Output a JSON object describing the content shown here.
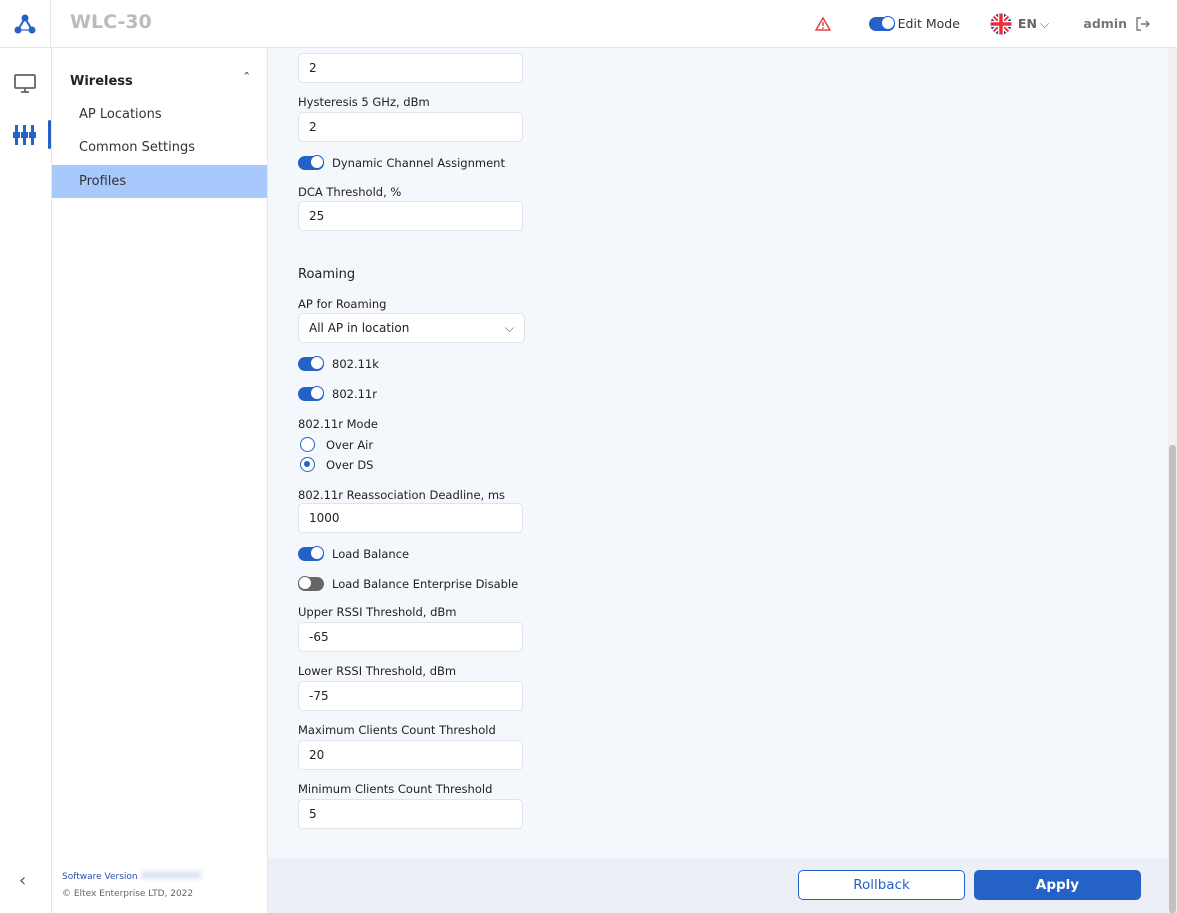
{
  "header": {
    "title": "WLC-30",
    "edit_mode_label": "Edit Mode",
    "language": "EN",
    "user": "admin"
  },
  "sidebar": {
    "group": "Wireless",
    "items": [
      {
        "label": "AP Locations"
      },
      {
        "label": "Common Settings"
      },
      {
        "label": "Profiles",
        "active": true
      }
    ],
    "software_version_label": "Software Version",
    "copyright": "© Eltex Enterprise LTD, 2022"
  },
  "form": {
    "field_top_value": "2",
    "hysteresis5_label": "Hysteresis 5 GHz, dBm",
    "hysteresis5_value": "2",
    "dca_label": "Dynamic Channel Assignment",
    "dca_on": true,
    "dca_threshold_label": "DCA Threshold, %",
    "dca_threshold_value": "25",
    "roaming_title": "Roaming",
    "ap_roaming_label": "AP for Roaming",
    "ap_roaming_value": "All AP in location",
    "k_label": "802.11k",
    "k_on": true,
    "r_label": "802.11r",
    "r_on": true,
    "r_mode_label": "802.11r Mode",
    "r_mode_options": [
      "Over Air",
      "Over DS"
    ],
    "r_mode_selected": "Over DS",
    "reassoc_label": "802.11r Reassociation Deadline, ms",
    "reassoc_value": "1000",
    "lb_label": "Load Balance",
    "lb_on": true,
    "lbe_label": "Load Balance Enterprise Disable",
    "lbe_on": false,
    "upper_rssi_label": "Upper RSSI Threshold, dBm",
    "upper_rssi_value": "-65",
    "lower_rssi_label": "Lower RSSI Threshold, dBm",
    "lower_rssi_value": "-75",
    "max_clients_label": "Maximum Clients Count Threshold",
    "max_clients_value": "20",
    "min_clients_label": "Minimum Clients Count Threshold",
    "min_clients_value": "5"
  },
  "footer": {
    "rollback": "Rollback",
    "apply": "Apply"
  },
  "colors": {
    "accent": "#2562c8",
    "active_item": "#a9c8fb",
    "alert": "#e8404a"
  }
}
